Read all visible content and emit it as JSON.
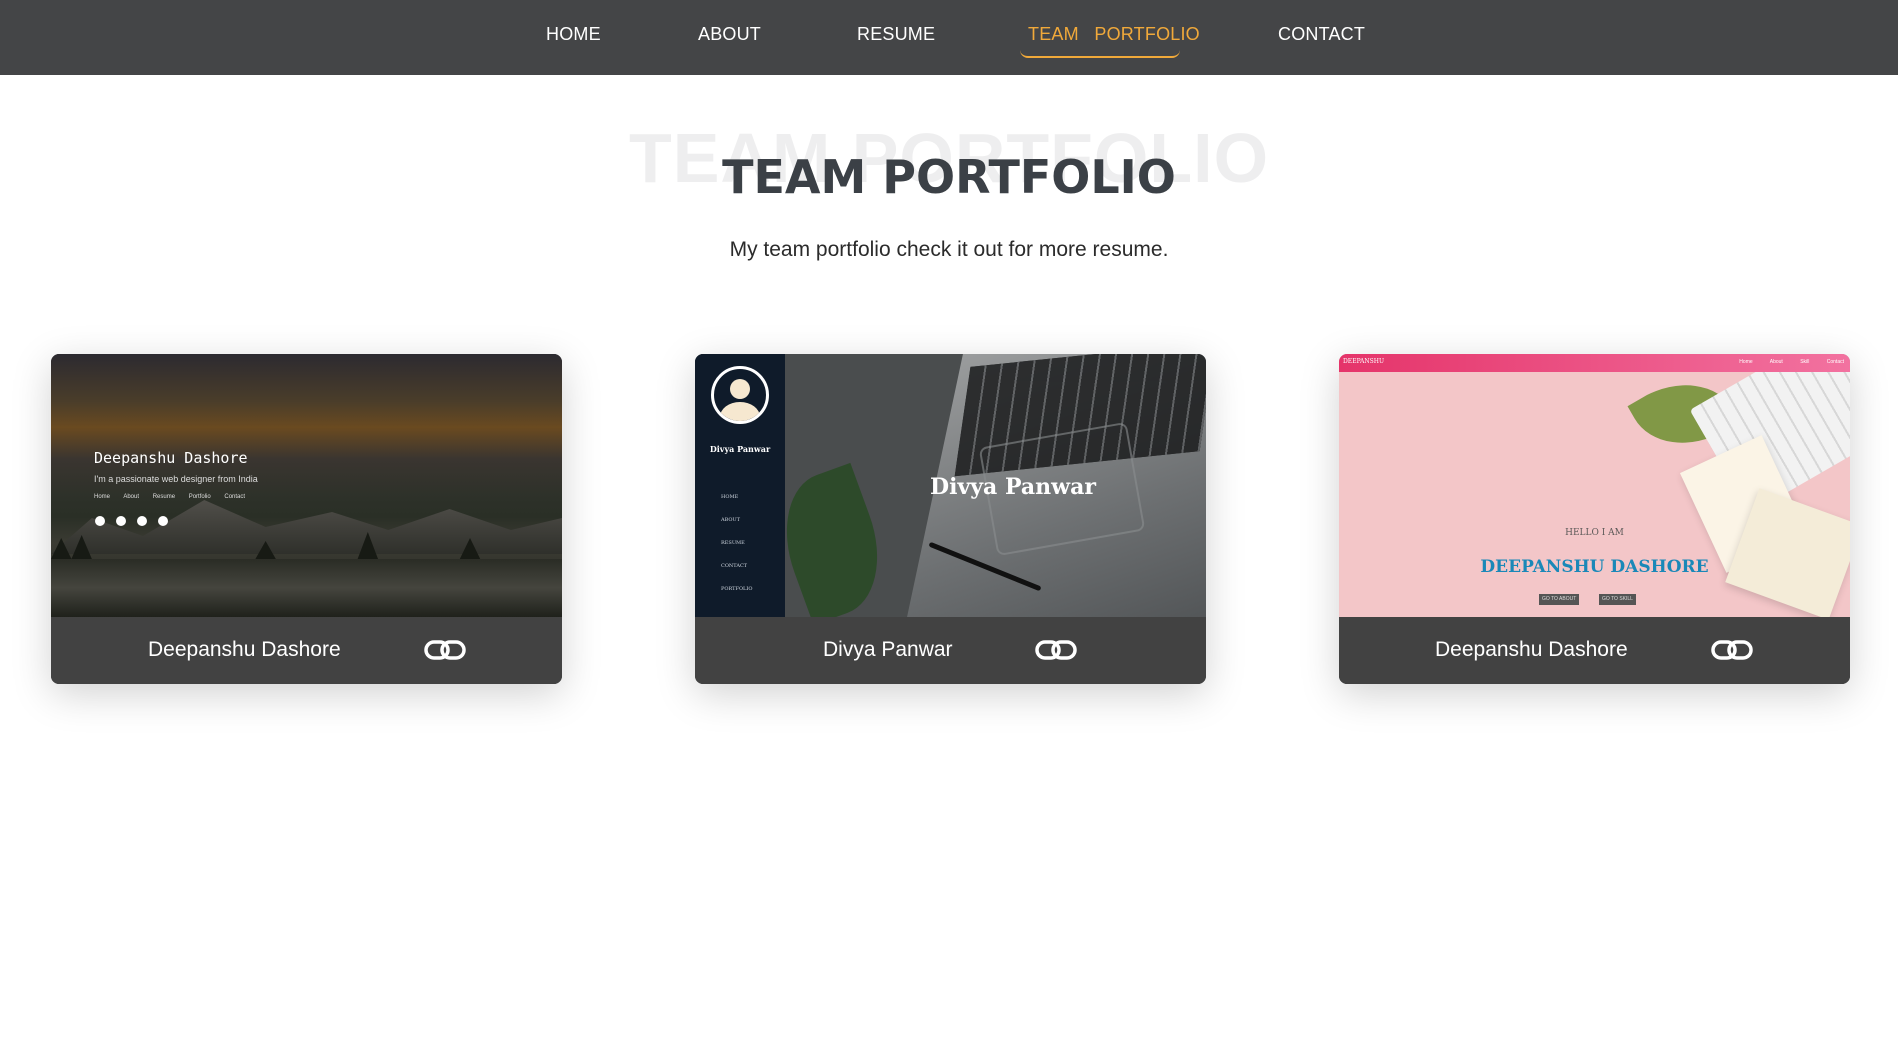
{
  "nav": {
    "items": [
      {
        "label": "HOME"
      },
      {
        "label": "ABOUT"
      },
      {
        "label": "RESUME"
      },
      {
        "label": "TEAM   PORTFOLIO",
        "active": true
      },
      {
        "label": "CONTACT"
      }
    ],
    "active_color": "#f1a93a",
    "bg_color": "#444547"
  },
  "section": {
    "bg_title": "TEAM PORTFOLIO",
    "title": "TEAM PORTFOLIO",
    "subtitle": "My team portfolio check it out for more resume."
  },
  "cards": [
    {
      "name": "Deepanshu Dashore",
      "link_icon": "link-icon",
      "thumb": {
        "heading": "Deepanshu Dashore",
        "tagline": "I'm a passionate web designer from India",
        "menu": "Home About Resume Portfolio Contact",
        "social_icons": [
          "twitter-icon",
          "facebook-icon",
          "instagram-icon",
          "linkedin-icon"
        ]
      }
    },
    {
      "name": "Divya Panwar",
      "link_icon": "link-icon",
      "thumb": {
        "heading": "Divya Panwar",
        "sidebar_name": "Divya Panwar",
        "menu": [
          "HOME",
          "ABOUT",
          "RESUME",
          "CONTACT",
          "PORTFOLIO"
        ]
      }
    },
    {
      "name": "Deepanshu Dashore",
      "link_icon": "link-icon",
      "thumb": {
        "brand": "DEEPANSHU",
        "links": "Home About Skill Contact",
        "hello": "HELLO I AM",
        "heading": "DEEPANSHU DASHORE",
        "btn1": "GO TO ABOUT",
        "btn2": "GO TO SKILL"
      }
    }
  ]
}
